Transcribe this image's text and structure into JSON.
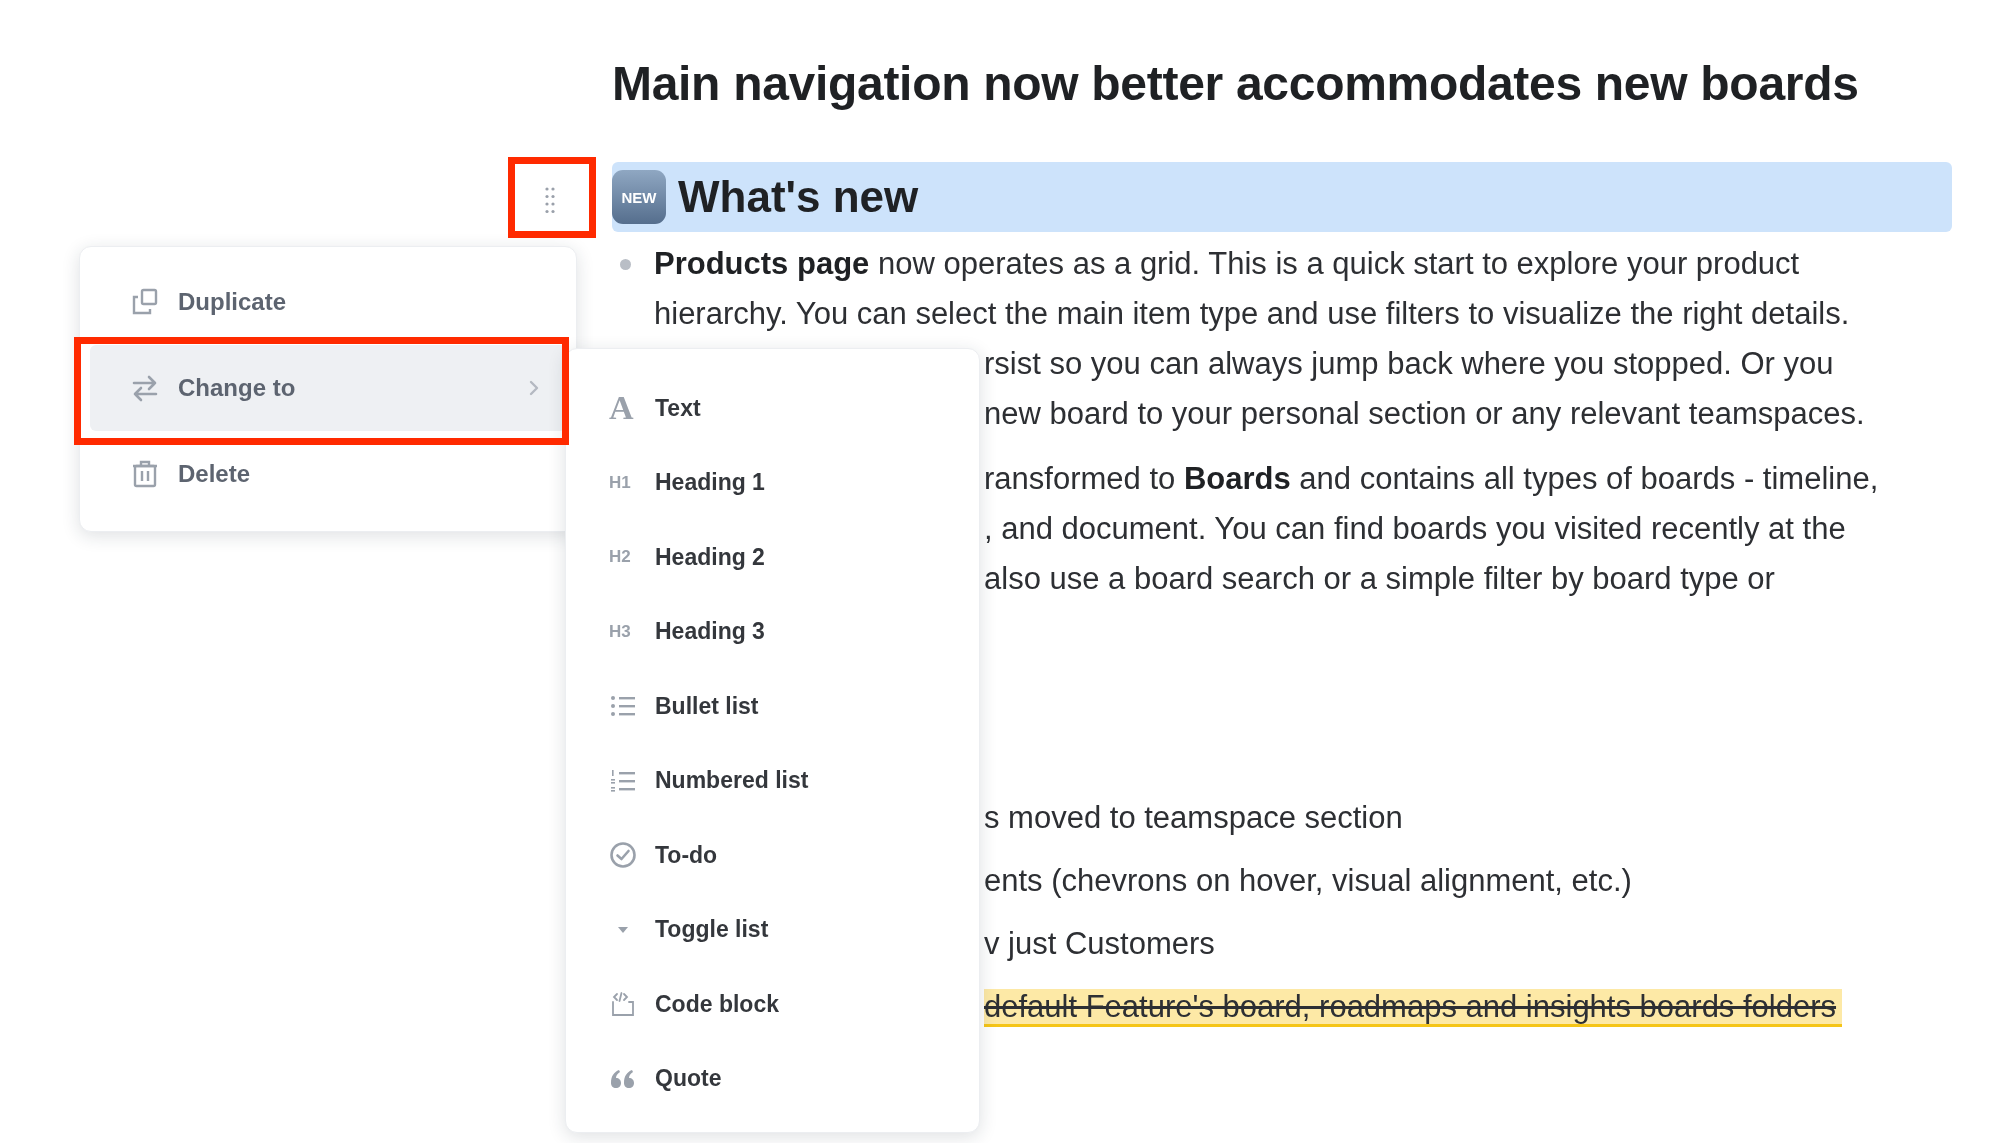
{
  "document": {
    "title": "Main navigation now better accommodates new boards",
    "heading": {
      "badge": "NEW",
      "text": "What's new"
    },
    "upper_blocks": [
      {
        "lines": [
          {
            "kind": "bullet",
            "text": "**Products page** now operates as a grid. This is a quick start to explore your product"
          },
          {
            "kind": "text",
            "text": "hierarchy. You can select the main item type and use filters to visualize the right details."
          },
          {
            "kind": "cut",
            "text": "rsist so you can always jump back where you stopped. Or you"
          },
          {
            "kind": "cut",
            "text": "new board to your personal section or any relevant teamspaces."
          }
        ]
      },
      {
        "lines": [
          {
            "kind": "cut",
            "text": "ransformed to **Boards** and contains all types of boards - timeline,"
          },
          {
            "kind": "cut",
            "text": ", and document. You can find boards you visited recently at the"
          },
          {
            "kind": "cut",
            "text": "also use a board search or a simple filter by board type or"
          }
        ]
      }
    ],
    "lower_blocks": [
      {
        "lines": [
          {
            "kind": "cut",
            "text": "s moved to teamspace section"
          }
        ]
      },
      {
        "lines": [
          {
            "kind": "cut",
            "text": "ents (chevrons on hover, visual alignment, etc.)"
          }
        ]
      },
      {
        "lines": [
          {
            "kind": "cut",
            "text": "v just Customers"
          }
        ]
      },
      {
        "lines": [
          {
            "kind": "struck",
            "text": "default Feature's board, roadmaps and insights boards folders"
          }
        ]
      }
    ]
  },
  "block_menu": {
    "items": [
      {
        "kind": "duplicate",
        "label": "Duplicate",
        "selected": false,
        "has_submenu": false
      },
      {
        "kind": "change",
        "label": "Change to",
        "selected": true,
        "has_submenu": true
      },
      {
        "kind": "delete",
        "label": "Delete",
        "selected": false,
        "has_submenu": false
      }
    ]
  },
  "change_to_menu": {
    "items": [
      {
        "kind": "text",
        "glyph": "A",
        "label": "Text"
      },
      {
        "kind": "heading",
        "glyph": "H1",
        "label": "Heading 1"
      },
      {
        "kind": "heading",
        "glyph": "H2",
        "label": "Heading 2"
      },
      {
        "kind": "heading",
        "glyph": "H3",
        "label": "Heading 3"
      },
      {
        "kind": "bullets",
        "label": "Bullet list"
      },
      {
        "kind": "numbers",
        "label": "Numbered list"
      },
      {
        "kind": "todo",
        "label": "To-do"
      },
      {
        "kind": "toggle",
        "label": "Toggle list"
      },
      {
        "kind": "code",
        "label": "Code block"
      },
      {
        "kind": "quote",
        "label": "Quote"
      }
    ]
  }
}
